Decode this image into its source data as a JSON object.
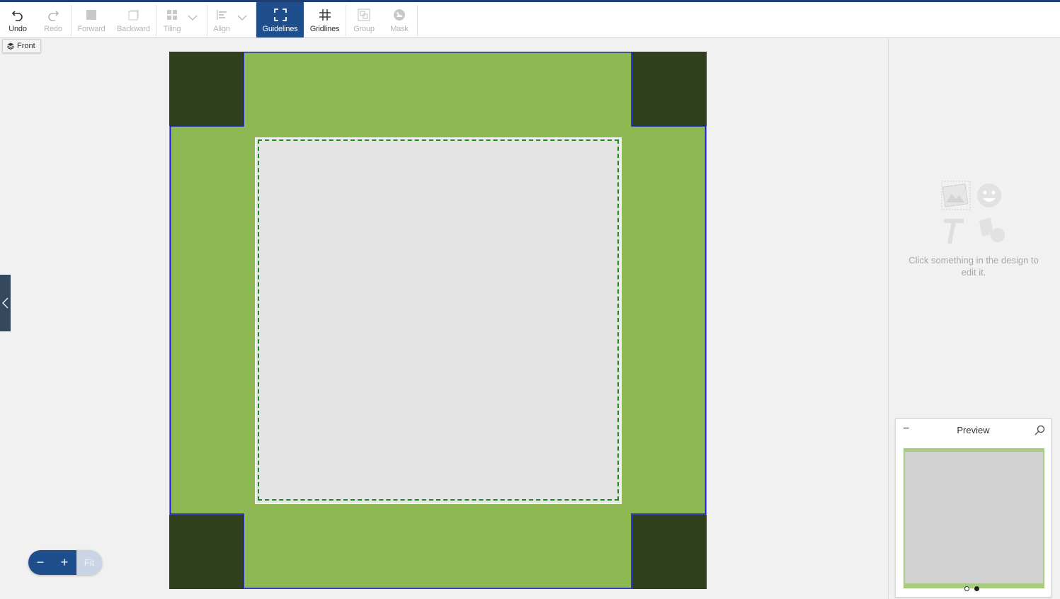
{
  "toolbar": {
    "undo": "Undo",
    "redo": "Redo",
    "forward": "Forward",
    "backward": "Backward",
    "tiling": "Tiling",
    "align": "Align",
    "guidelines": "Guidelines",
    "gridlines": "Gridlines",
    "group": "Group",
    "mask": "Mask"
  },
  "canvas": {
    "side_label": "Front",
    "design_color": "#8db852",
    "corner_color": "#30401d",
    "print_area_color": "#e4e4e4",
    "safe_line_color": "#1f8a22",
    "bleed_line_color": "#1a1adb"
  },
  "zoom": {
    "minus": "−",
    "plus": "+",
    "fit": "Fit"
  },
  "right_panel": {
    "hint": "Click something in the design to edit it."
  },
  "preview": {
    "title": "Preview",
    "collapse": "−",
    "pages": 2,
    "current_page": 2
  },
  "colors": {
    "accent": "#1f4e8c",
    "disabled": "#b5b5b5"
  }
}
